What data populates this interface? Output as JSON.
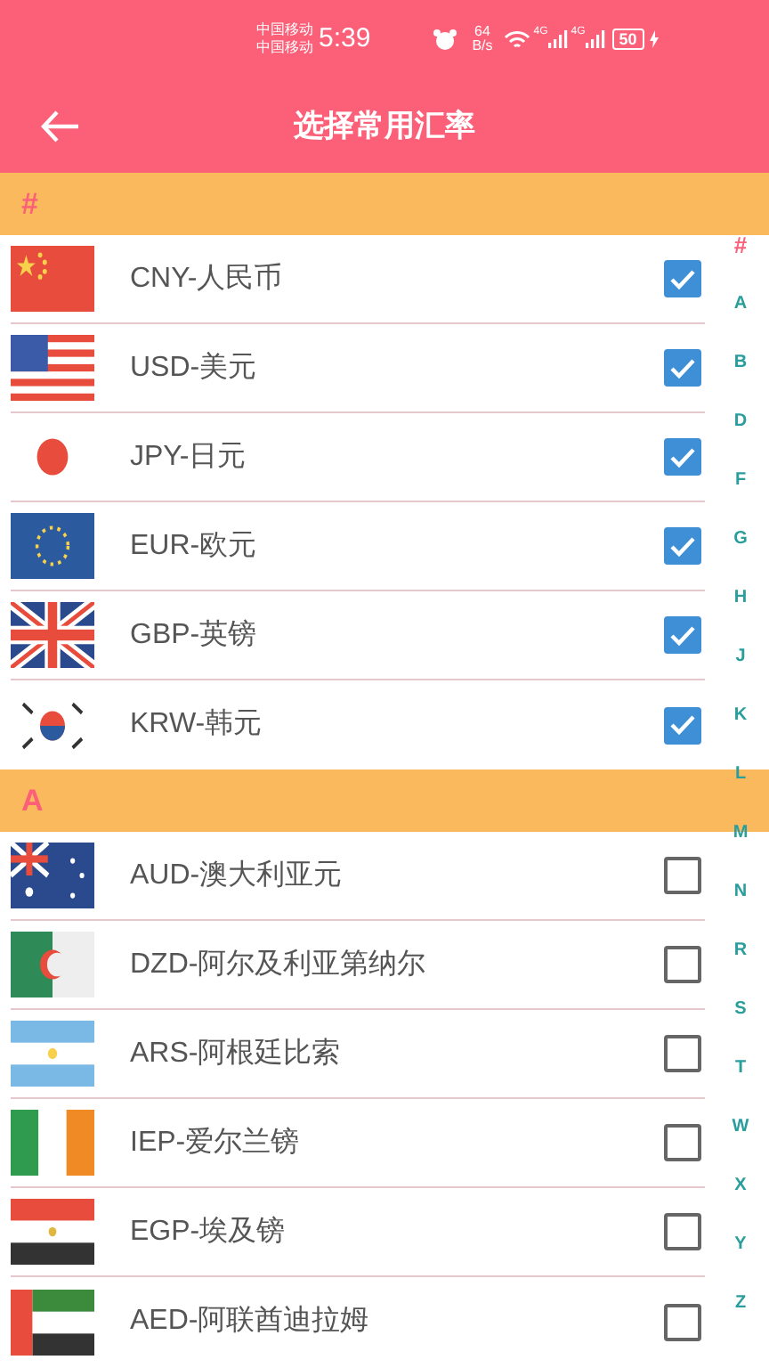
{
  "status_bar": {
    "carriers": [
      "中国移动",
      "中国移动"
    ],
    "time": "5:39",
    "speed": [
      "64",
      "B/s"
    ],
    "signal_labels": [
      "4G",
      "4G"
    ],
    "battery": "50"
  },
  "header": {
    "title": "选择常用汇率"
  },
  "sections": [
    {
      "heading": "#",
      "rows": [
        {
          "label": "CNY-人民币",
          "checked": true
        },
        {
          "label": "USD-美元",
          "checked": true
        },
        {
          "label": "JPY-日元",
          "checked": true
        },
        {
          "label": "EUR-欧元",
          "checked": true
        },
        {
          "label": "GBP-英镑",
          "checked": true
        },
        {
          "label": "KRW-韩元",
          "checked": true
        }
      ]
    },
    {
      "heading": "A",
      "rows": [
        {
          "label": "AUD-澳大利亚元",
          "checked": false
        },
        {
          "label": "DZD-阿尔及利亚第纳尔",
          "checked": false
        },
        {
          "label": "ARS-阿根廷比索",
          "checked": false
        },
        {
          "label": "IEP-爱尔兰镑",
          "checked": false
        },
        {
          "label": "EGP-埃及镑",
          "checked": false
        },
        {
          "label": "AED-阿联酋迪拉姆",
          "checked": false
        }
      ]
    }
  ],
  "index_bar": [
    "#",
    "A",
    "B",
    "D",
    "F",
    "G",
    "H",
    "J",
    "K",
    "L",
    "M",
    "N",
    "R",
    "S",
    "T",
    "W",
    "X",
    "Y",
    "Z"
  ]
}
